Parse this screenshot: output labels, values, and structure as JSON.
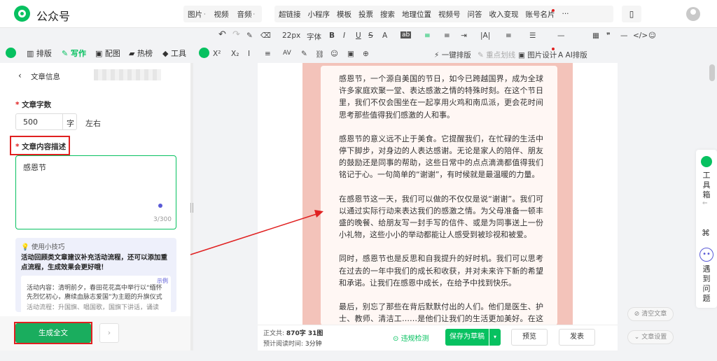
{
  "topbar": {
    "brand": "公众号",
    "menu1": [
      "图片",
      "视频",
      "音频"
    ],
    "menu2": [
      "超链接",
      "小程序",
      "模板",
      "投票",
      "搜索",
      "地理位置",
      "视频号",
      "问答",
      "收入变现",
      "账号名片",
      "···"
    ],
    "phone_icon": "phone-icon",
    "avatar_icon": "user-icon"
  },
  "toolbar1": {
    "undo": "↶",
    "redo": "↷",
    "format_brush": "✎",
    "clear": "⌫",
    "font_size": "22px",
    "font_family": "字体",
    "bold": "B",
    "italic": "I",
    "underline": "U",
    "strike": "S",
    "font_color": "A",
    "bg_color": "ab",
    "align_left": "≡",
    "align_center": "≡",
    "indent": "⇥",
    "line": "|A|",
    "justify": "≡",
    "list": "☰",
    "divider": "—",
    "table": "▦",
    "quote": "❞",
    "hr": "—",
    "code": "</>",
    "emoji": "☺"
  },
  "toolbar2": {
    "sup": "X²",
    "sub": "X₂",
    "spacing": "I",
    "line_height": "≡",
    "letter": "AV",
    "magic": "✎",
    "link": "⛓",
    "smiley": "☺",
    "block": "▣",
    "gift": "⊕",
    "one_click": "一键排版",
    "key_pt": "重点划线",
    "image_design": "图片设计",
    "ai_layout": "AI排版"
  },
  "left_tabs": [
    "排版",
    "写作",
    "配图",
    "热榜",
    "工具"
  ],
  "left_panel": {
    "back_label": "文章信息",
    "word_count_label": "文章字数",
    "word_count_value": "500",
    "word_unit": "字",
    "word_approx": "左右",
    "desc_label": "文章内容描述",
    "desc_value": "感恩节",
    "desc_count": "3/300",
    "tip_badge": "使用小技巧",
    "tip_title": "活动回顾类文章建议补充活动流程，还可以添加重点流程，生成效果会更好哦！",
    "example_badge": "示例",
    "example_line1": "活动内容：清明前夕，春田花花高中举行以“缅怀先烈忆初心，赓续血脉志爱国”为主题的升旗仪式",
    "example_line2": "活动流程：升国旗、唱国歌，国旗下讲话，诵读",
    "generate_button": "生成全文"
  },
  "article": {
    "paragraphs": [
      "感恩节，一个源自美国的节日，如今已跨越国界，成为全球许多家庭欢聚一堂、表达感激之情的特殊时刻。在这个节日里，我们不仅会围坐在一起享用火鸡和南瓜派，更会花时间思考那些值得我们感激的人和事。",
      "感恩节的意义远不止于美食。它提醒我们，在忙碌的生活中停下脚步，对身边的人表达感谢。无论是家人的陪伴、朋友的鼓励还是同事的帮助，这些日常中的点点滴滴都值得我们铭记于心。一句简单的“谢谢”，有时候就是最温暖的力量。",
      "在感恩节这一天，我们可以做的不仅仅是说“谢谢”。我们可以通过实际行动来表达我们的感激之情。为父母准备一顿丰盛的晚餐、给朋友写一封手写的信件、或是为同事送上一份小礼物，这些小小的举动都能让人感受到被珍视和被爱。",
      "同时，感恩节也是反思和自我提升的好时机。我们可以思考在过去的一年中我们的成长和收获，并对未来许下新的希望和承诺。让我们在感恩中成长，在给予中找到快乐。",
      "最后，别忘了那些在背后默默付出的人们。他们是医生、护士、教师、清洁工……是他们让我们的生活更加美好。在这个特别的日子里，让我们也向他们说一声“谢谢”，因为他们的"
    ]
  },
  "bottom_bar": {
    "word_count_label": "正文共:",
    "word_count_value": "870字 31图",
    "read_time_label": "预计阅读时间:",
    "read_time_value": "3分钟",
    "violation_check": "违规检测",
    "save_draft": "保存为草稿",
    "preview": "预览",
    "publish": "发表"
  },
  "right": {
    "clear_label": "清空文章",
    "settings_label": "文章设置",
    "toolbox": [
      "工",
      "具",
      "箱"
    ],
    "question": [
      "遇",
      "到",
      "问",
      "题"
    ]
  },
  "colors": {
    "brand_green": "#07c160",
    "highlight_red": "#e02020",
    "card_pink": "#f3c3ba"
  }
}
